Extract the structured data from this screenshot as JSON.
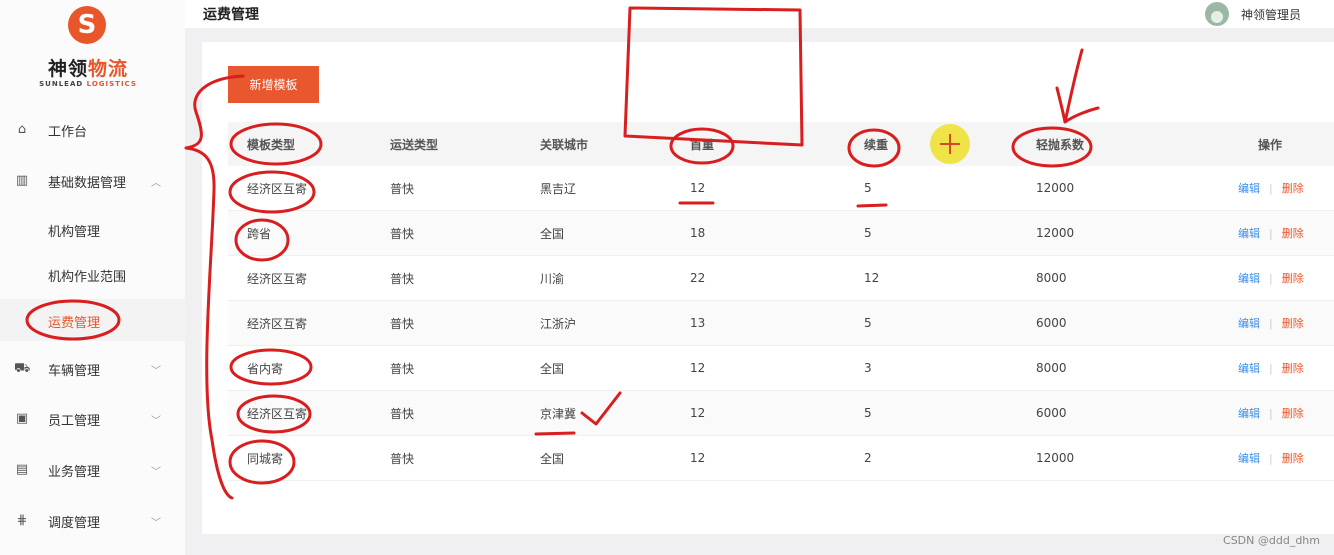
{
  "sidebar": {
    "logo": {
      "mark": "S",
      "name_part1": "神领",
      "name_part2": "物流",
      "en_part1": "SUNLEAD",
      "en_part2": "LOGISTICS"
    },
    "items": [
      {
        "label": "工作台",
        "icon": "home-icon"
      },
      {
        "label": "基础数据管理",
        "icon": "chart-icon",
        "expanded": true,
        "children": [
          {
            "label": "机构管理"
          },
          {
            "label": "机构作业范围"
          },
          {
            "label": "运费管理",
            "active": true
          }
        ]
      },
      {
        "label": "车辆管理",
        "icon": "truck-icon"
      },
      {
        "label": "员工管理",
        "icon": "id-card-icon"
      },
      {
        "label": "业务管理",
        "icon": "briefcase-icon"
      },
      {
        "label": "调度管理",
        "icon": "dispatch-icon"
      }
    ]
  },
  "header": {
    "title": "运费管理",
    "user_name": "神领管理员"
  },
  "main": {
    "add_button_label": "新增模板",
    "table": {
      "headers": [
        "模板类型",
        "运送类型",
        "关联城市",
        "首重",
        "续重",
        "轻抛系数",
        "操作"
      ],
      "rows": [
        [
          "经济区互寄",
          "普快",
          "黑吉辽",
          "12",
          "5",
          "12000"
        ],
        [
          "跨省",
          "普快",
          "全国",
          "18",
          "5",
          "12000"
        ],
        [
          "经济区互寄",
          "普快",
          "川渝",
          "22",
          "12",
          "8000"
        ],
        [
          "经济区互寄",
          "普快",
          "江浙沪",
          "13",
          "5",
          "6000"
        ],
        [
          "省内寄",
          "普快",
          "全国",
          "12",
          "3",
          "8000"
        ],
        [
          "经济区互寄",
          "普快",
          "京津冀",
          "12",
          "5",
          "6000"
        ],
        [
          "同城寄",
          "普快",
          "全国",
          "12",
          "2",
          "12000"
        ]
      ],
      "edit_label": "编辑",
      "separator": "|",
      "delete_label": "删除"
    }
  },
  "annotation_color": "#d81e1e",
  "watermark": "CSDN @ddd_dhm"
}
